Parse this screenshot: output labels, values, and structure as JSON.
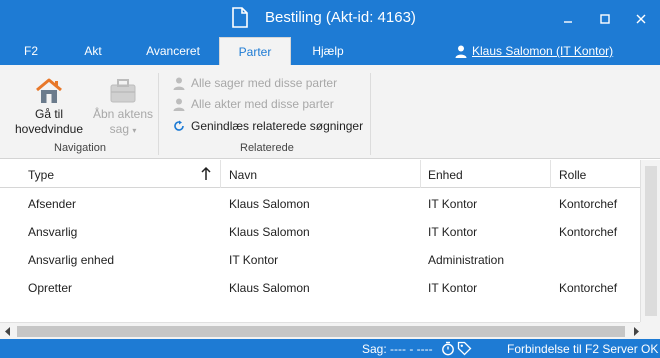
{
  "window": {
    "title": "Bestiling (Akt-id: 4163)"
  },
  "menu": {
    "items": [
      {
        "label": "F2"
      },
      {
        "label": "Akt"
      },
      {
        "label": "Avanceret"
      },
      {
        "label": "Parter"
      },
      {
        "label": "Hjælp"
      }
    ],
    "active": "Parter",
    "user": "Klaus Salomon (IT Kontor)"
  },
  "ribbon": {
    "navigation": {
      "home_line1": "Gå til",
      "home_line2": "hovedvindue",
      "open_line1": "Åbn aktens",
      "open_line2": "sag",
      "group_label": "Navigation"
    },
    "related": {
      "all_cases": "Alle sager med disse parter",
      "all_acts": "Alle akter med disse parter",
      "reload": "Genindlæs relaterede søgninger",
      "group_label": "Relaterede"
    }
  },
  "grid": {
    "columns": [
      "Type",
      "Navn",
      "Enhed",
      "Rolle"
    ],
    "rows": [
      {
        "type": "Afsender",
        "navn": "Klaus Salomon",
        "enhed": "IT Kontor",
        "rolle": "Kontorchef"
      },
      {
        "type": "Ansvarlig",
        "navn": "Klaus Salomon",
        "enhed": "IT Kontor",
        "rolle": "Kontorchef"
      },
      {
        "type": "Ansvarlig enhed",
        "navn": "IT Kontor",
        "enhed": "Administration",
        "rolle": ""
      },
      {
        "type": "Opretter",
        "navn": "Klaus Salomon",
        "enhed": "IT Kontor",
        "rolle": "Kontorchef"
      }
    ]
  },
  "status": {
    "sag": "Sag: ---- - ----",
    "server": "Forbindelse til F2 Server OK"
  },
  "colors": {
    "accent": "#1e7bd4",
    "ribbon_bg": "#f3f3f3"
  }
}
